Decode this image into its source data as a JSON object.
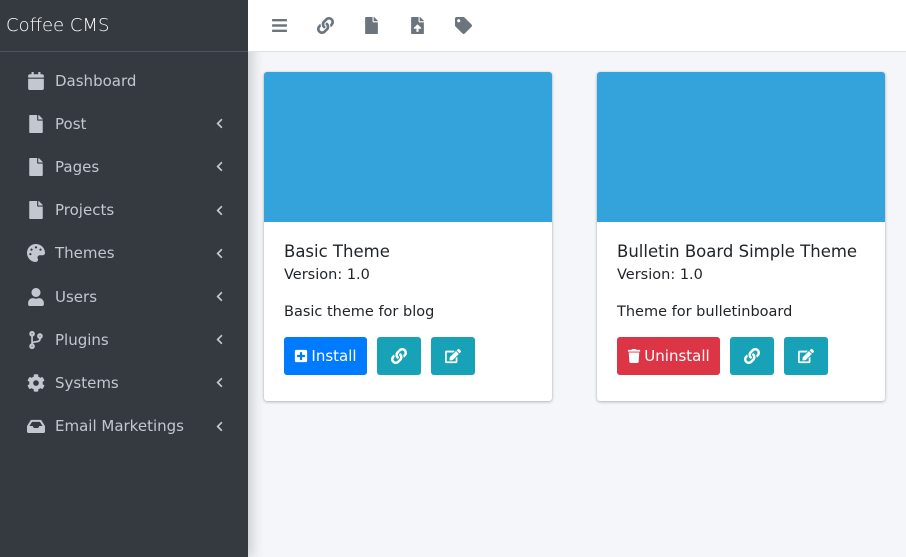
{
  "app": {
    "brand": "Coffee CMS"
  },
  "sidebar": {
    "items": [
      {
        "label": "Dashboard",
        "icon": "calendar-icon",
        "has_submenu": false
      },
      {
        "label": "Post",
        "icon": "file-icon",
        "has_submenu": true
      },
      {
        "label": "Pages",
        "icon": "file-icon",
        "has_submenu": true
      },
      {
        "label": "Projects",
        "icon": "file-icon",
        "has_submenu": true
      },
      {
        "label": "Themes",
        "icon": "palette-icon",
        "has_submenu": true
      },
      {
        "label": "Users",
        "icon": "user-icon",
        "has_submenu": true
      },
      {
        "label": "Plugins",
        "icon": "code-branch-icon",
        "has_submenu": true
      },
      {
        "label": "Systems",
        "icon": "gear-icon",
        "has_submenu": true
      },
      {
        "label": "Email Marketings",
        "icon": "inbox-icon",
        "has_submenu": true
      }
    ]
  },
  "topbar": {
    "buttons": [
      "menu-icon",
      "link-icon",
      "file-icon",
      "file-upload-icon",
      "tag-icon"
    ]
  },
  "themes": [
    {
      "title": "Basic Theme",
      "version": "Version: 1.0",
      "description": "Basic theme for blog",
      "action_label": "Install",
      "action_type": "install",
      "image_color": "#34a3db"
    },
    {
      "title": "Bulletin Board Simple Theme",
      "version": "Version: 1.0",
      "description": "Theme for bulletinboard",
      "action_label": "Uninstall",
      "action_type": "uninstall",
      "image_color": "#34a3db"
    }
  ],
  "colors": {
    "sidebar_bg": "#343a40",
    "primary": "#007bff",
    "danger": "#dc3545",
    "info": "#17a2b8",
    "card_image": "#34a3db",
    "content_bg": "#f4f6f9"
  }
}
